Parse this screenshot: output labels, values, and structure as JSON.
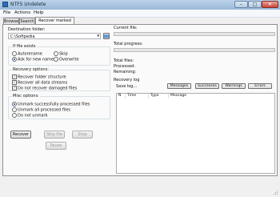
{
  "window": {
    "title": "NTFS Undelete",
    "min": "–",
    "max": "□",
    "close": "✕"
  },
  "menu": [
    "File",
    "Actions",
    "Help"
  ],
  "tabs": [
    "Browse",
    "Search",
    "Recover marked files"
  ],
  "destination": {
    "label": "Destination folder:",
    "value": "C:\\Softpedia",
    "browse": "…"
  },
  "if_exists": {
    "title": "If file exists",
    "options": [
      "Autorename",
      "Skip",
      "Ask for new name",
      "Overwrite"
    ],
    "selected": "Ask for new name"
  },
  "recovery_options": {
    "title": "Recovery options:",
    "items": [
      {
        "label": "Recover folder structure",
        "checked": true
      },
      {
        "label": "Recover all data streams",
        "checked": true
      },
      {
        "label": "Do not recover damaged files",
        "checked": true
      }
    ]
  },
  "misc_options": {
    "title": "Misc options:",
    "options": [
      "Unmark successfully processed files",
      "Unmark all processed files",
      "Do not unmark"
    ],
    "selected": "Unmark successfully processed files"
  },
  "buttons": {
    "recover": "Recover",
    "skip": "Skip file",
    "stop": "Stop",
    "pause": "Pause"
  },
  "progress": {
    "current_label": "Current file:",
    "total_label": "Total progress:",
    "current_value": 0,
    "total_value": 0
  },
  "stats": [
    "Total files:",
    "Processed:",
    "Remaining:"
  ],
  "log": {
    "title": "Recovery log",
    "save": "Save log...",
    "filters": [
      "Messages",
      "Successes",
      "Warnings",
      "Errors"
    ],
    "columns": [
      "N",
      "Time",
      "Type",
      "Message"
    ]
  }
}
